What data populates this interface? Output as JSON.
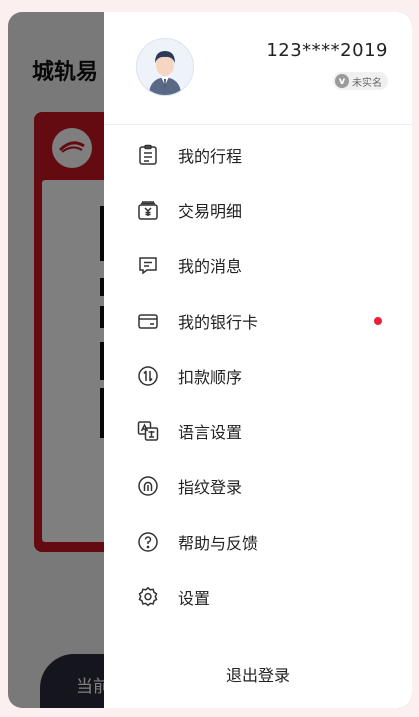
{
  "background_app": {
    "title": "城轨易",
    "bottom_text": "当前"
  },
  "user": {
    "phone": "123****2019",
    "verify_status": "未实名",
    "verify_icon": "v-badge-icon"
  },
  "menu": [
    {
      "label": "我的行程",
      "icon": "itinerary-icon"
    },
    {
      "label": "交易明细",
      "icon": "transaction-icon"
    },
    {
      "label": "我的消息",
      "icon": "message-icon"
    },
    {
      "label": "我的银行卡",
      "icon": "bank-card-icon",
      "has_dot": true
    },
    {
      "label": "扣款顺序",
      "icon": "deduction-order-icon"
    },
    {
      "label": "语言设置",
      "icon": "language-icon"
    },
    {
      "label": "指纹登录",
      "icon": "fingerprint-icon"
    },
    {
      "label": "帮助与反馈",
      "icon": "help-icon"
    },
    {
      "label": "设置",
      "icon": "settings-icon"
    }
  ],
  "logout_label": "退出登录",
  "colors": {
    "accent_red": "#e8203c",
    "card_red": "#c81523",
    "icon_stroke": "#333333"
  }
}
